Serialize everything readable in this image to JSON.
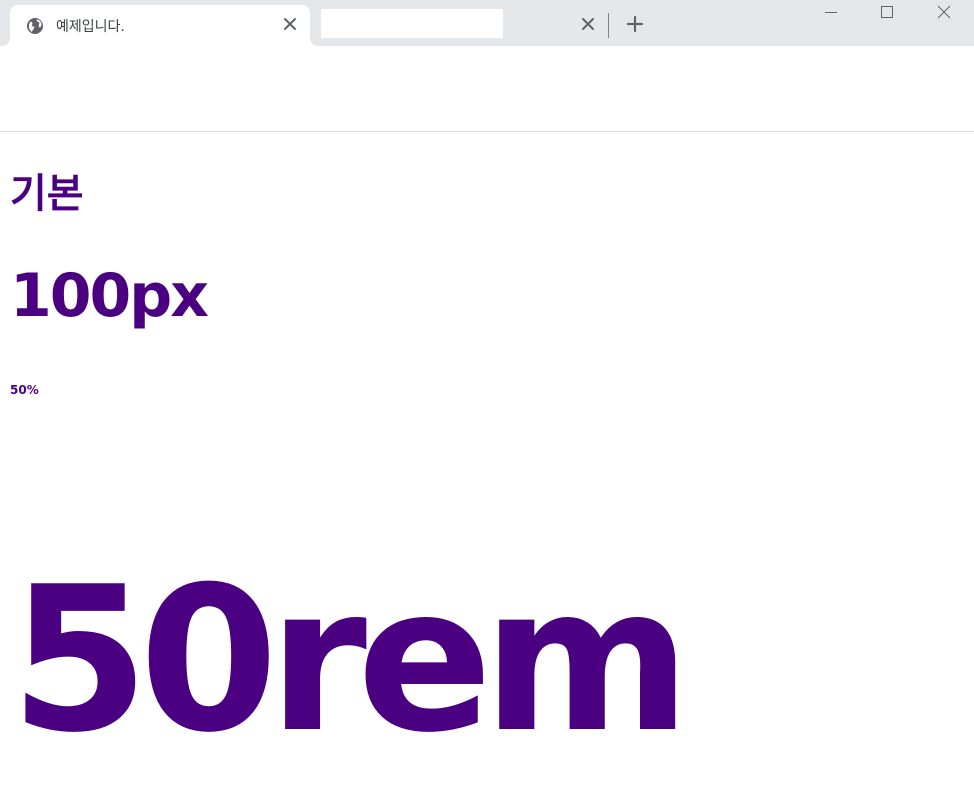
{
  "browser": {
    "tabs": [
      {
        "title": "예제입니다.",
        "icon": "globe-icon",
        "active": true
      },
      {
        "title": "",
        "active": false
      }
    ],
    "controls": {
      "new_tab_icon": "plus-icon",
      "minimize_icon": "minimize-icon",
      "maximize_icon": "maximize-icon",
      "close_icon": "close-icon"
    }
  },
  "page": {
    "headings": {
      "basic": "기본",
      "px100": "100px",
      "pct50": "50%",
      "rem50": "50rem"
    },
    "colors": {
      "heading": "#4b0082"
    }
  }
}
